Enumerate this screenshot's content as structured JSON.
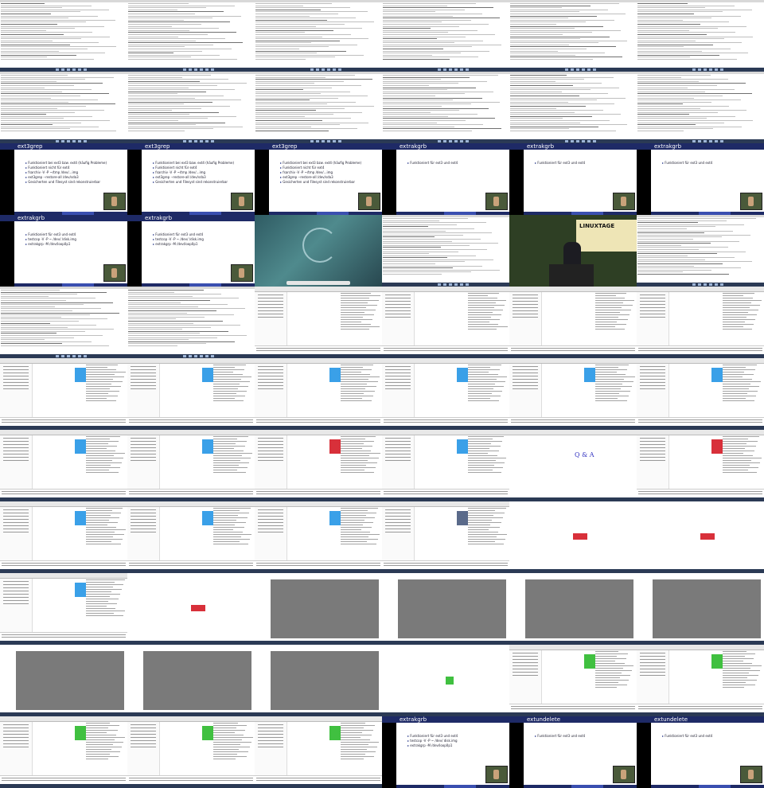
{
  "slides": {
    "a": {
      "title": "ext3grep",
      "items": [
        "Funktioniert bei ext3 bzw. ext4 (häufig Probleme)",
        "Funktioniert nicht für ext4",
        "fsarchiv -V -P ~/tmp /dev/...img",
        "ext3grep --restore-all /dev/sda3",
        "Gesicherten und Filesyst sind rekonstruierbar"
      ]
    },
    "b": {
      "title": "extrakgrb",
      "items": [
        "Funktioniert für ext3 und ext4"
      ]
    },
    "c": {
      "title": "extrakgrb",
      "items": [
        "Funktioniert für ext3 und ext4",
        "testcop -V -P ~ /dev/ /disk.img",
        "extrakgrp -M /dev/loop0p1"
      ]
    },
    "d": {
      "title": "extundelete",
      "items": [
        "Funktioniert für ext3 und ext4"
      ]
    },
    "e": {
      "title": "extrakgrb",
      "items": [
        "Funktioniert für ext3 und ext4",
        "testcop -V -P ~ /dev/ disk.img",
        "extrakgrp -M /dev/loop0p1"
      ]
    }
  },
  "qa_text": "Q & A",
  "photo_banner": "LINUXTAGE",
  "colors": {
    "slide_header": "#1e2a66",
    "taskbar": "#2b3a55",
    "accent_blue": "#3aa0e8",
    "accent_red": "#d8303a",
    "accent_green": "#40c040"
  },
  "tiles": [
    "terminal",
    "terminal",
    "terminal",
    "terminal",
    "terminal",
    "terminal",
    "terminal",
    "terminal",
    "terminal",
    "terminal",
    "terminal",
    "terminal",
    "slide:a",
    "slide:a",
    "slide:a",
    "slide:b",
    "slide:b",
    "slide:b",
    "slide:c",
    "slide:c",
    "desktop",
    "terminal",
    "photo",
    "terminal",
    "terminal",
    "terminal",
    "fm-text",
    "fm-text",
    "fm-text",
    "fm-text",
    "fm",
    "fm",
    "fm",
    "fm",
    "fm",
    "fm",
    "fm",
    "fm",
    "fm-red",
    "fm",
    "qa",
    "fm-red",
    "fm",
    "fm",
    "fm",
    "fm-dark",
    "viewer-red",
    "viewer-red",
    "fm",
    "viewer-red",
    "grey",
    "grey",
    "grey",
    "grey",
    "grey",
    "grey",
    "grey",
    "viewer-green",
    "fm-green",
    "fm-green",
    "fm-green",
    "fm-green",
    "fm-green",
    "slide:e",
    "slide:d",
    "slide:d"
  ]
}
